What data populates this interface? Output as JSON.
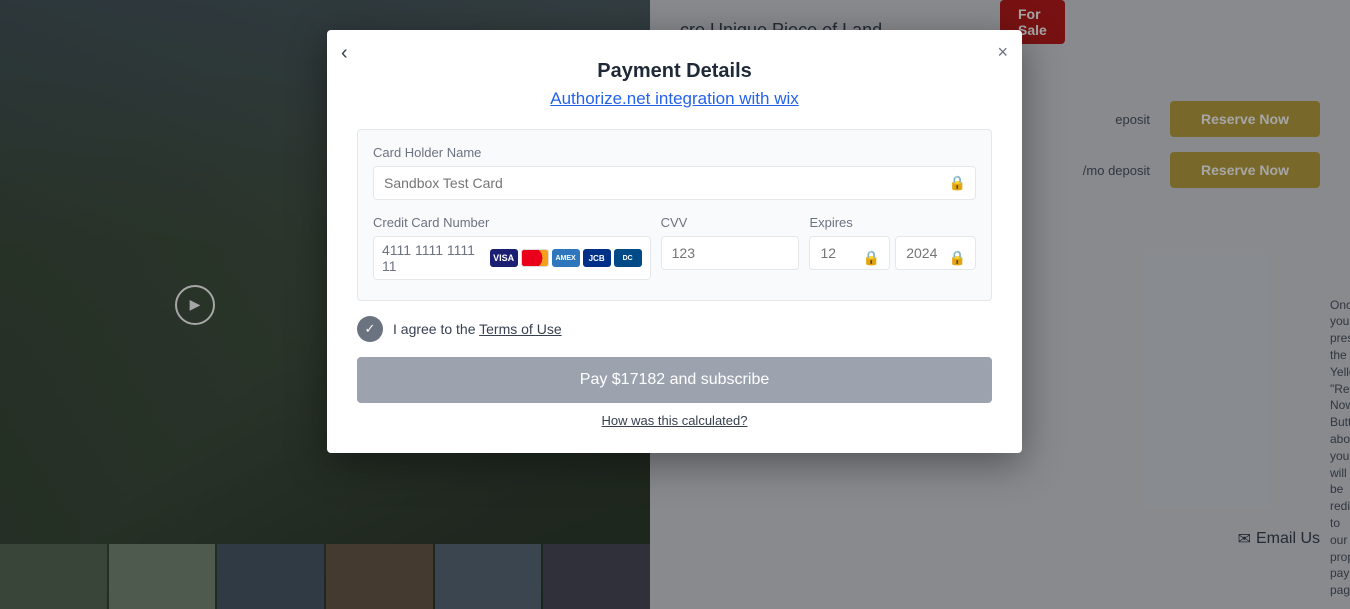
{
  "background": {
    "for_sale_label": "For Sale"
  },
  "sidebar": {
    "title": "cre Unique Piece of Land",
    "reserve_rows": [
      {
        "label": "eposit",
        "button_label": "Reserve Now"
      },
      {
        "label": "/mo\ndeposit",
        "button_label": "Reserve Now"
      }
    ],
    "email_label": "Email Us",
    "bottom_text": "Once you press the Yellow \"Reserve Now\" Button above, you will be redirected to our property payment page."
  },
  "modal": {
    "title": "Payment Details",
    "link_text": "Authorize.net integration with wix",
    "close_label": "×",
    "back_label": "‹",
    "card_holder": {
      "label": "Card Holder Name",
      "placeholder": "Sandbox Test Card"
    },
    "credit_card": {
      "label": "Credit Card Number",
      "value": "4111 1111 1111 11",
      "card_icons": [
        "VISA",
        "MC",
        "AMEX",
        "JCB",
        "DC"
      ]
    },
    "cvv": {
      "label": "CVV",
      "placeholder": "123"
    },
    "expires": {
      "label": "Expires",
      "month_placeholder": "12",
      "year_placeholder": "2024"
    },
    "agree_text": "I agree to the ",
    "terms_link": "Terms of Use",
    "pay_button": "Pay $17182 and subscribe",
    "calculated_link": "How was this calculated?"
  }
}
